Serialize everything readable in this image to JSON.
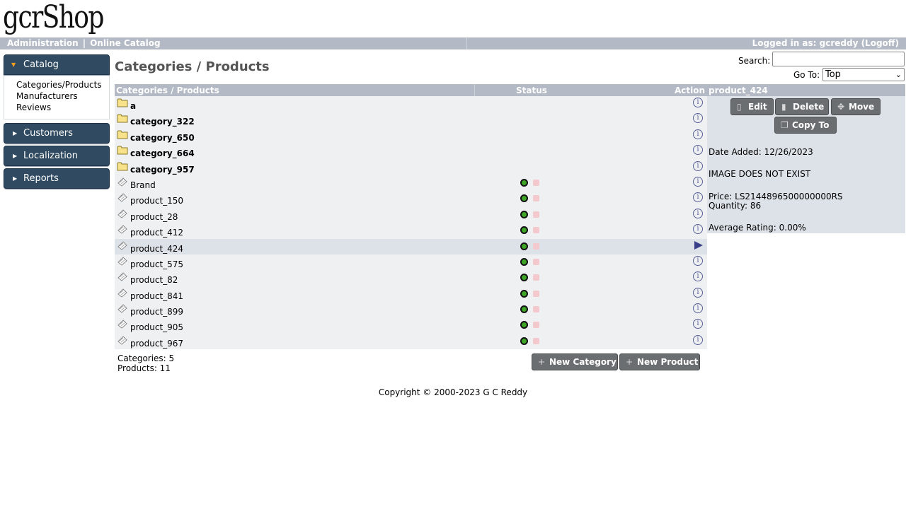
{
  "logo": "gcrShop",
  "header": {
    "admin": "Administration",
    "separator": "|",
    "online_catalog": "Online Catalog",
    "logged_in": "Logged in as: gcreddy (Logoff)"
  },
  "sidebar": {
    "catalog": "Catalog",
    "catalog_items": [
      "Categories/Products",
      "Manufacturers",
      "Reviews"
    ],
    "customers": "Customers",
    "localization": "Localization",
    "reports": "Reports"
  },
  "page_title": "Categories / Products",
  "search": {
    "label": "Search:",
    "value": ""
  },
  "goto": {
    "label": "Go To:",
    "value": "Top"
  },
  "table": {
    "headers": {
      "name": "Categories / Products",
      "status": "Status",
      "action": "Action"
    },
    "categories": [
      "a",
      "category_322",
      "category_650",
      "category_664",
      "category_957"
    ],
    "products": [
      "Brand",
      "product_150",
      "product_28",
      "product_412",
      "product_424",
      "product_575",
      "product_82",
      "product_841",
      "product_899",
      "product_905",
      "product_967"
    ],
    "selected": "product_424",
    "info_glyph": "i"
  },
  "counts": {
    "categories": "Categories: 5",
    "products": "Products: 11"
  },
  "buttons": {
    "new_category": "New Category",
    "new_product": "New Product",
    "edit": "Edit",
    "delete": "Delete",
    "move": "Move",
    "copy_to": "Copy To"
  },
  "panel": {
    "title": "product_424",
    "date_added": "Date Added: 12/26/2023",
    "image_note": "IMAGE DOES NOT EXIST",
    "price": "Price: LS2144896500000000RS",
    "quantity": "Quantity: 86",
    "rating": "Average Rating: 0.00%"
  },
  "copyright": "Copyright © 2000-2023 G C Reddy",
  "icons": {
    "folder": "folder-icon",
    "product": "product-icon",
    "info": "info-icon",
    "selected": "selected-arrow-icon"
  },
  "colors": {
    "header_bar": "#b3bac5",
    "nav_dark": "#2f4a61",
    "status_on": "#3fa526",
    "status_off": "#f3c9cd",
    "button": "#6b6e71"
  }
}
